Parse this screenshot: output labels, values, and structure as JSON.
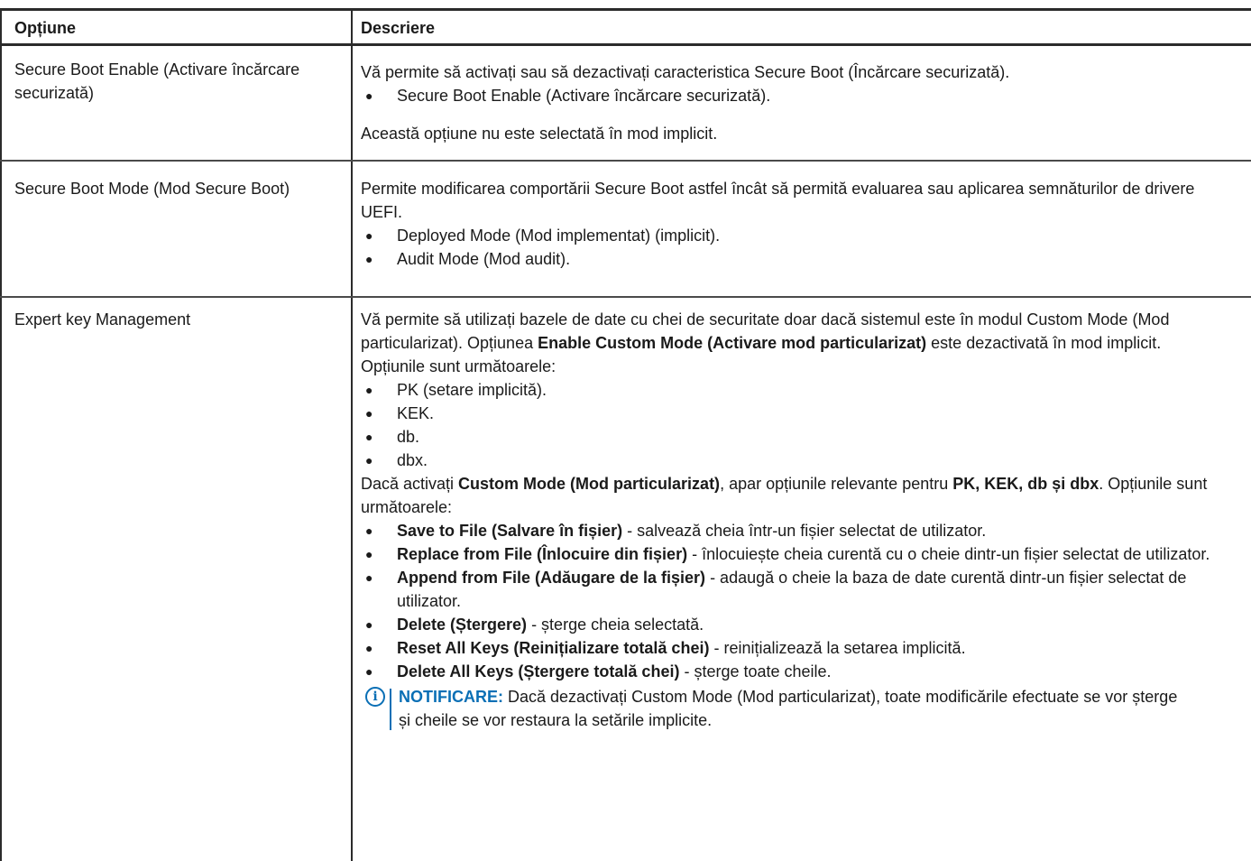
{
  "header": {
    "col1": "Opțiune",
    "col2": "Descriere"
  },
  "row1": {
    "option": "Secure Boot Enable (Activare încărcare securizată)",
    "desc_p1": "Vă permite să activați sau să dezactivați caracteristica Secure Boot (Încărcare securizată).",
    "bullets": [
      "Secure Boot Enable (Activare încărcare securizată)."
    ],
    "desc_p2": "Această opțiune nu este selectată în mod implicit."
  },
  "row2": {
    "option": "Secure Boot Mode (Mod Secure Boot)",
    "desc_p1": "Permite modificarea comportării Secure Boot astfel încât să permită evaluarea sau aplicarea semnăturilor de drivere UEFI.",
    "bullets": [
      "Deployed Mode (Mod implementat) (implicit).",
      "Audit Mode (Mod audit)."
    ]
  },
  "row3": {
    "option": "Expert key Management",
    "p1_a": "Vă permite să utilizați bazele de date cu chei de securitate doar dacă sistemul este în modul Custom Mode (Mod particularizat). Opțiunea ",
    "p1_b": "Enable Custom Mode (Activare mod particularizat)",
    "p1_c": " este dezactivată în mod implicit. Opțiunile sunt următoarele:",
    "keys": [
      "PK (setare implicită).",
      "KEK.",
      "db.",
      "dbx."
    ],
    "p2_a": "Dacă activați ",
    "p2_b": "Custom Mode (Mod particularizat)",
    "p2_c": ", apar opțiunile relevante pentru ",
    "p2_d": "PK, KEK, db și dbx",
    "p2_e": ". Opțiunile sunt următoarele:",
    "actions": [
      {
        "name": "Save to File (Salvare în fișier)",
        "desc": " - salvează cheia într-un fișier selectat de utilizator."
      },
      {
        "name": "Replace from File (Înlocuire din fișier)",
        "desc": " - înlocuiește cheia curentă cu o cheie dintr-un fișier selectat de utilizator."
      },
      {
        "name": "Append from File (Adăugare de la fișier)",
        "desc": " - adaugă o cheie la baza de date curentă dintr-un fișier selectat de utilizator."
      },
      {
        "name": "Delete (Ștergere)",
        "desc": " - șterge cheia selectată."
      },
      {
        "name": "Reset All Keys (Reinițializare totală chei)",
        "desc": " - reinițializează la setarea implicită."
      },
      {
        "name": "Delete All Keys (Ștergere totală chei)",
        "desc": " - șterge toate cheile."
      }
    ],
    "note_icon": "info-icon",
    "note_label": "NOTIFICARE:",
    "note_text": " Dacă dezactivați Custom Mode (Mod particularizat), toate modificările efectuate se vor șterge și cheile se vor restaura la setările implicite."
  }
}
